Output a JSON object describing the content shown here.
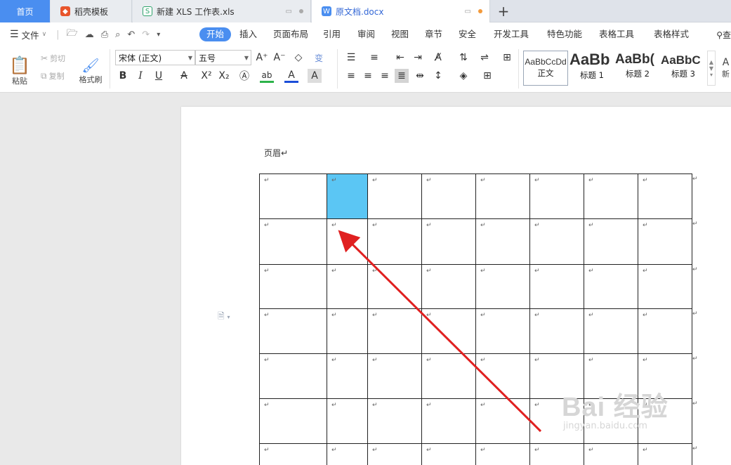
{
  "tabs": {
    "home": "首页",
    "template": "稻壳模板",
    "xls": "新建 XLS 工作表.xls",
    "docx": "原文档.docx",
    "new_tab": "+"
  },
  "menu": {
    "file": "文件",
    "items": [
      "开始",
      "插入",
      "页面布局",
      "引用",
      "审阅",
      "视图",
      "章节",
      "安全",
      "开发工具",
      "特色功能",
      "表格工具",
      "表格样式"
    ],
    "search": "查"
  },
  "ribbon": {
    "paste": "粘贴",
    "cut": "剪切",
    "copy": "复制",
    "format_painter": "格式刷",
    "font_name": "宋体 (正文)",
    "font_size": "五号",
    "styles": [
      {
        "preview": "AaBbCcDd",
        "label": "正文"
      },
      {
        "preview": "AaBb",
        "label": "标题 1"
      },
      {
        "preview": "AaBb(",
        "label": "标题 2"
      },
      {
        "preview": "AaBbC",
        "label": "标题 3"
      }
    ],
    "new_style": "新"
  },
  "document": {
    "header_text": "页眉↵",
    "cell_mark": "↵",
    "rows": 7,
    "cols": 8,
    "highlight_cell": {
      "row": 0,
      "col": 1
    },
    "highlight_color": "#5bc6f4"
  },
  "annotation": {
    "arrow_color": "#e02020"
  },
  "watermark": {
    "main": "Bai 经验",
    "sub": "jingyan.baidu.com"
  },
  "colors": {
    "accent": "#4a8ef0",
    "tab_active_text": "#3367d6"
  }
}
